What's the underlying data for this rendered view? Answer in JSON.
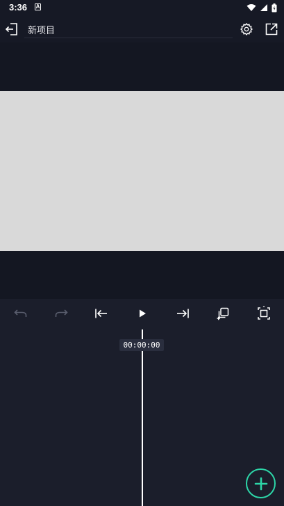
{
  "status_bar": {
    "time": "3:36",
    "notification_icon": "a-icon",
    "icons": [
      "wifi-icon",
      "signal-icon",
      "battery-icon"
    ]
  },
  "toolbar": {
    "back_icon": "exit-icon",
    "project_title": "新项目",
    "settings_icon": "gear-icon",
    "export_icon": "share-external-icon"
  },
  "playback": {
    "undo_icon": "undo-icon",
    "redo_icon": "redo-icon",
    "skip_start_icon": "skip-to-start-icon",
    "play_icon": "play-icon",
    "skip_end_icon": "skip-to-end-icon",
    "duplicate_icon": "duplicate-icon",
    "fit_icon": "fit-frame-icon"
  },
  "timeline": {
    "timecode": "00:00:00"
  },
  "fab": {
    "icon": "plus-icon",
    "accent_color": "#2dd6a8"
  },
  "colors": {
    "background": "#1b1e2b",
    "toolbar": "#161925",
    "preview_bg": "#141722",
    "canvas": "#d9d9d9",
    "disabled_icon": "#5a5e6e"
  }
}
